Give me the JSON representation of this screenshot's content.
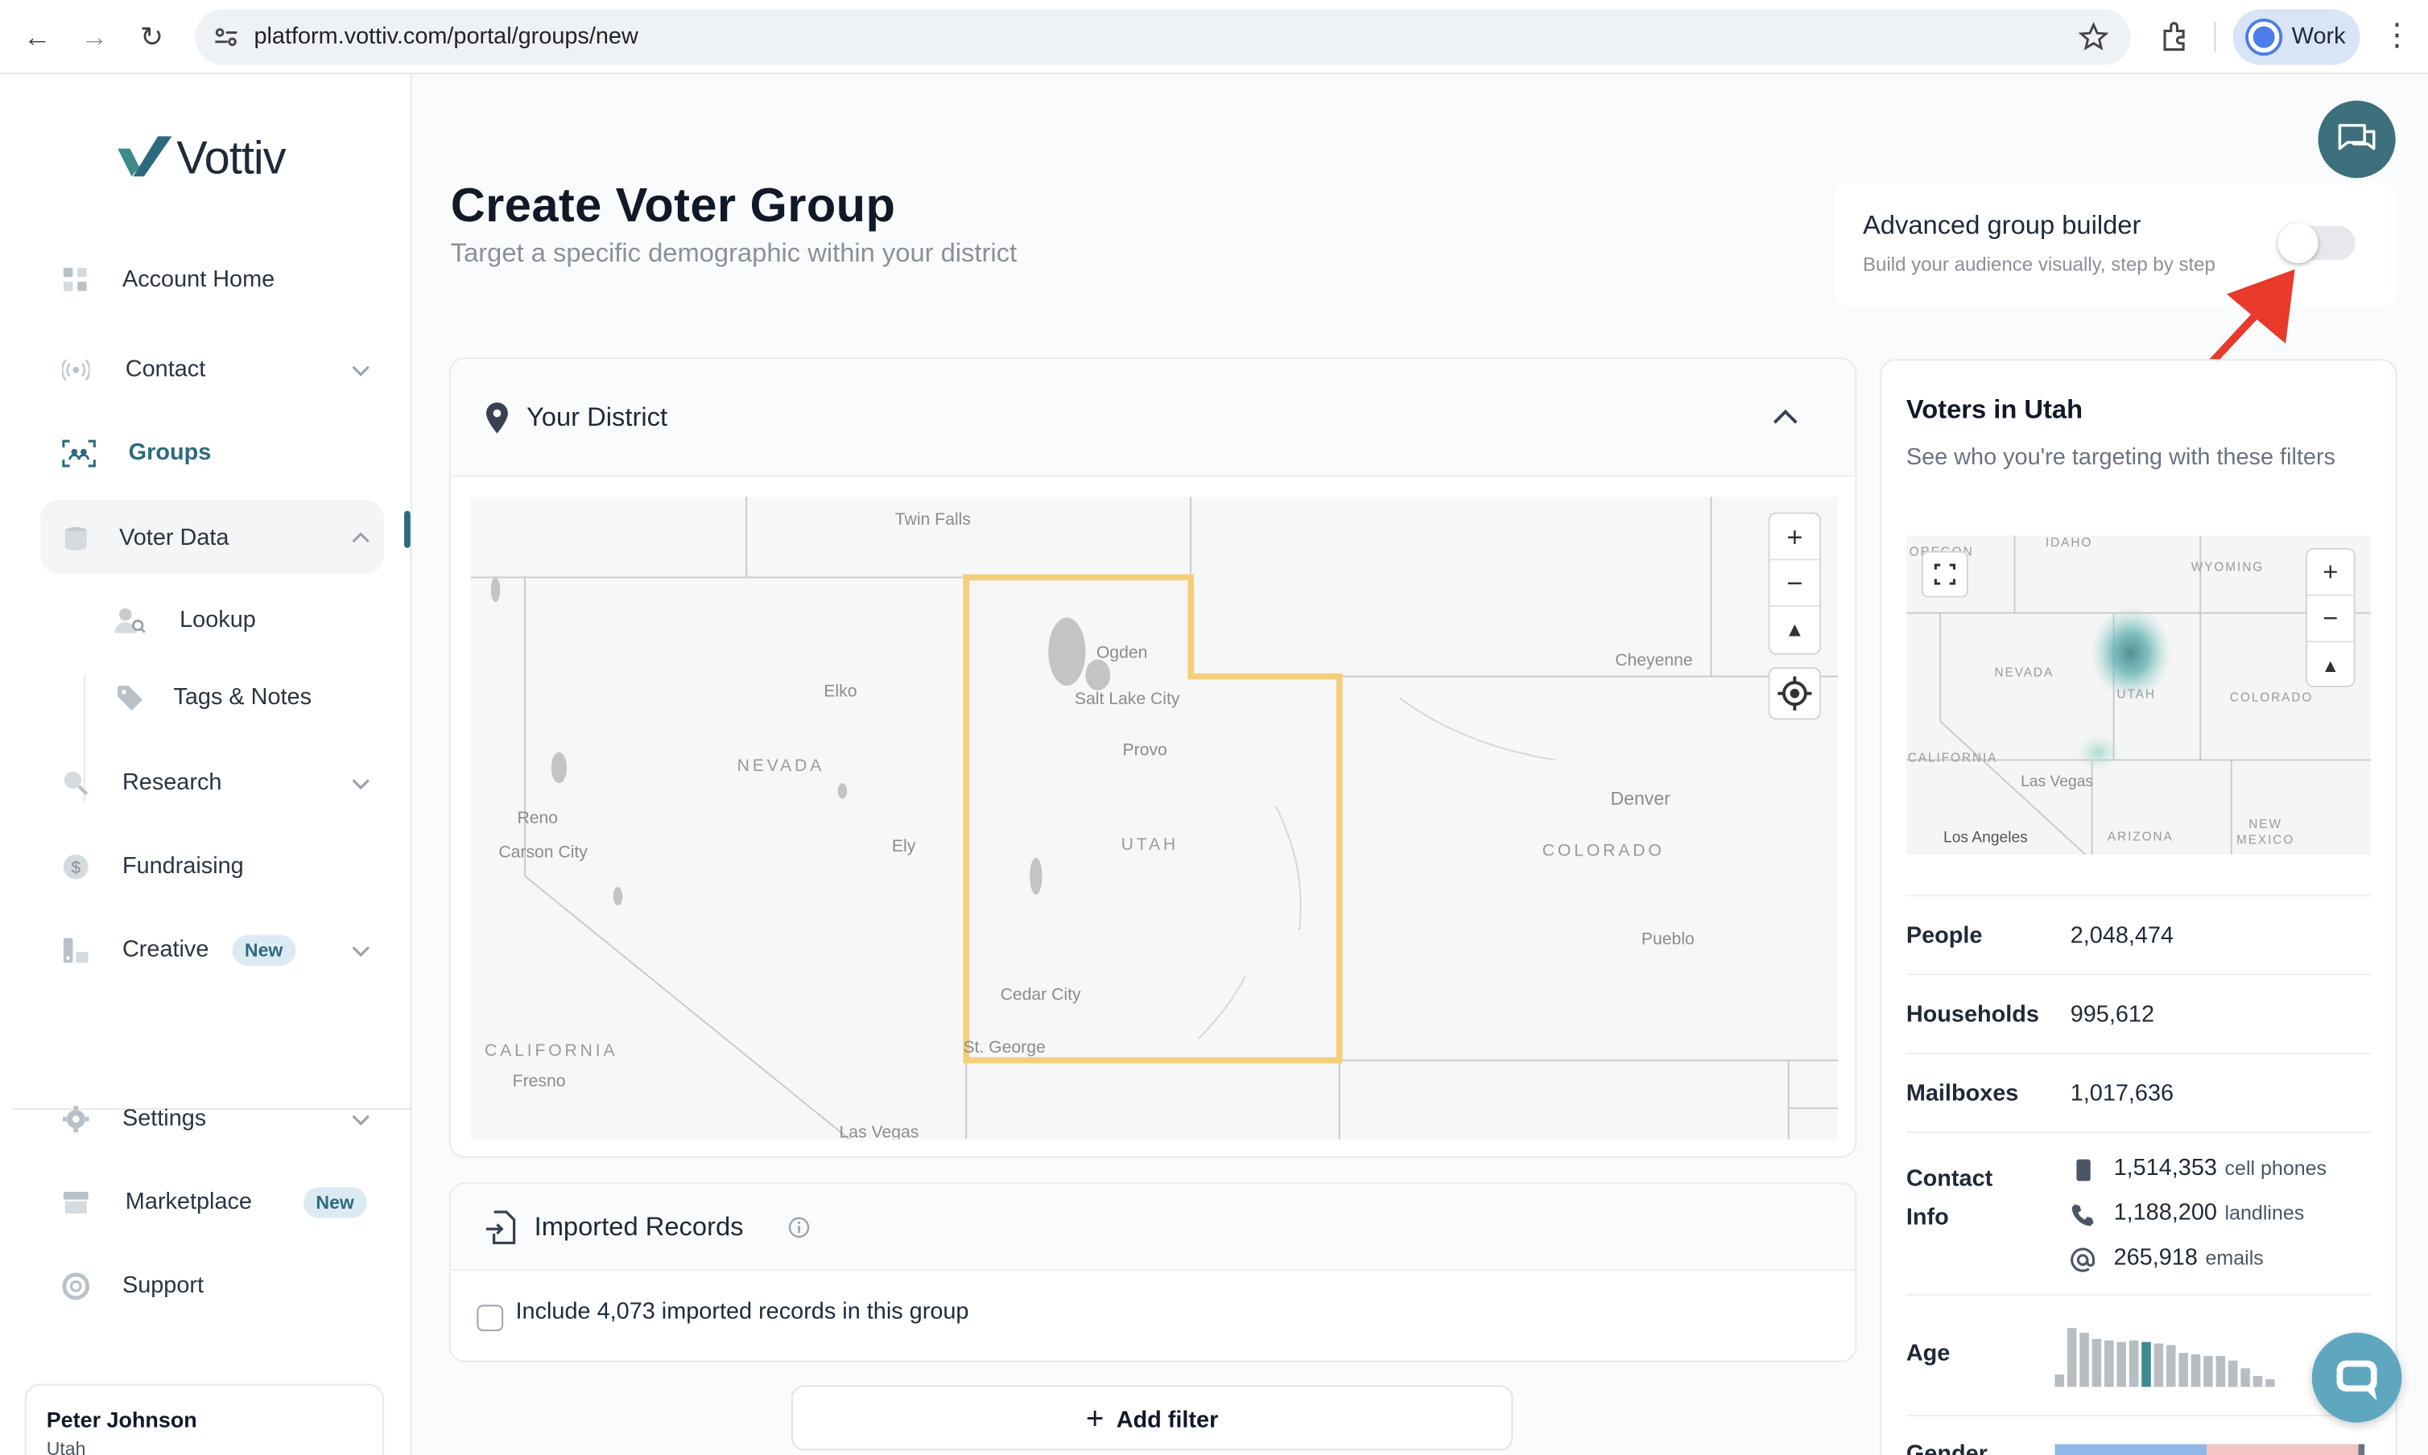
{
  "browser": {
    "url": "platform.vottiv.com/portal/groups/new",
    "profile": "Work"
  },
  "sidebar": {
    "brand": "Vottiv",
    "items": [
      {
        "label": "Account Home"
      },
      {
        "label": "Contact"
      },
      {
        "label": "Groups"
      },
      {
        "label": "Voter Data"
      },
      {
        "label": "Research"
      },
      {
        "label": "Fundraising"
      },
      {
        "label": "Creative",
        "badge": "New"
      },
      {
        "label": "Settings"
      },
      {
        "label": "Marketplace",
        "badge": "New"
      },
      {
        "label": "Support"
      }
    ],
    "sub_items": [
      {
        "label": "Lookup"
      },
      {
        "label": "Tags & Notes"
      }
    ],
    "user": {
      "name": "Peter Johnson",
      "state": "Utah"
    }
  },
  "page": {
    "title": "Create Voter Group",
    "subtitle": "Target a specific demographic within your district"
  },
  "advanced": {
    "title": "Advanced group builder",
    "subtitle": "Build your audience visually, step by step",
    "enabled": false
  },
  "district": {
    "title": "Your District",
    "map_labels": {
      "twin_falls": "Twin Falls",
      "elko": "Elko",
      "ogden": "Ogden",
      "salt_lake": "Salt Lake City",
      "provo": "Provo",
      "cheyenne": "Cheyenne",
      "nevada": "NEVADA",
      "utah": "UTAH",
      "colorado": "COLORADO",
      "california": "CALIFORNIA",
      "reno": "Reno",
      "carson": "Carson City",
      "ely": "Ely",
      "denver": "Denver",
      "pueblo": "Pueblo",
      "cedar": "Cedar City",
      "st_george": "St. George",
      "fresno": "Fresno",
      "las_vegas": "Las Vegas"
    }
  },
  "imported": {
    "title": "Imported Records",
    "checkbox_label": "Include 4,073 imported records in this group",
    "checked": false
  },
  "add_filter": "Add filter",
  "voters": {
    "title": "Voters in Utah",
    "subtitle": "See who you're targeting with these filters",
    "mini_map_labels": {
      "oregon": "OREGON",
      "idaho": "IDAHO",
      "wyoming": "WYOMING",
      "nevada": "NEVADA",
      "utah": "UTAH",
      "colorado": "COLORADO",
      "california": "CALIFORNIA",
      "las_vegas": "Las Vegas",
      "los_angeles": "Los Angeles",
      "arizona": "ARIZONA",
      "new_mexico": "NEW MEXICO"
    },
    "stats": [
      {
        "label": "People",
        "value": "2,048,474"
      },
      {
        "label": "Households",
        "value": "995,612"
      },
      {
        "label": "Mailboxes",
        "value": "1,017,636"
      }
    ],
    "contact_label": "Contact Info",
    "contact": [
      {
        "value": "1,514,353",
        "unit": "cell phones",
        "icon": "phone-icon"
      },
      {
        "value": "1,188,200",
        "unit": "landlines",
        "icon": "landline-icon"
      },
      {
        "value": "265,918",
        "unit": "emails",
        "icon": "at-icon"
      }
    ],
    "age_label": "Age",
    "gender_label": "Gender"
  },
  "colors": {
    "accent": "#2d6a7d",
    "district_outline": "#f4cf7a",
    "annotation_arrow": "#e8392b"
  }
}
